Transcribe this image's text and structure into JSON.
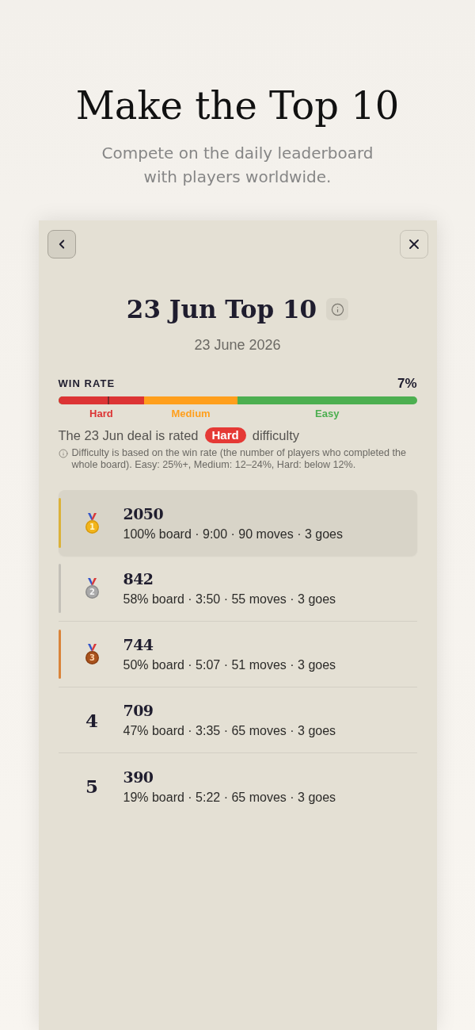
{
  "hero": {
    "title": "Make the Top 10",
    "subtitle": "Compete on the daily leaderboard with players worldwide."
  },
  "panel": {
    "title": "23 Jun Top 10",
    "date": "23 June 2026"
  },
  "win_rate": {
    "label": "WIN RATE",
    "value": "7%",
    "level": 0.14,
    "segments": [
      {
        "label": "Hard",
        "color": "#dc3434"
      },
      {
        "label": "Medium",
        "color": "#ff9f1c"
      },
      {
        "label": "Easy",
        "color": "#4caf50"
      }
    ]
  },
  "rating": {
    "text_before": "The 23 Jun deal is rated",
    "badge": "Hard",
    "text_after": "difficulty"
  },
  "note": "Difficulty is based on the win rate (the number of players who completed the whole board). Easy: 25%+, Medium: 12–24%, Hard: below 12%.",
  "leaderboard": [
    {
      "kind": "gold",
      "rank": "1",
      "color": "#dbb23a",
      "highlighted": true,
      "score": "2050",
      "details": "100% board · 9:00 · 90 moves · 3 goes"
    },
    {
      "kind": "silver",
      "rank": "2",
      "color": "#c3c0b8",
      "highlighted": false,
      "score": "842",
      "details": "58% board · 3:50 · 55 moves · 3 goes"
    },
    {
      "kind": "bronze",
      "rank": "3",
      "color": "#d9843a",
      "highlighted": false,
      "score": "744",
      "details": "50% board · 5:07 · 51 moves · 3 goes"
    },
    {
      "kind": "number",
      "rank": "4",
      "highlighted": false,
      "score": "709",
      "details": "47% board · 3:35 · 65 moves · 3 goes"
    },
    {
      "kind": "number",
      "rank": "5",
      "highlighted": false,
      "score": "390",
      "details": "19% board · 5:22 · 65 moves · 3 goes"
    }
  ]
}
